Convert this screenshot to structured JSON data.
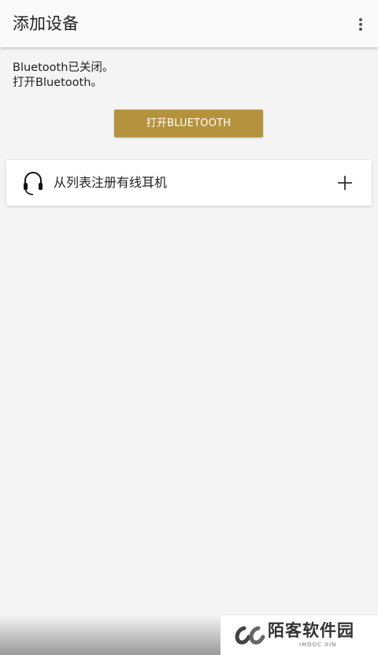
{
  "app_bar": {
    "title": "添加设备",
    "menu_icon": "more-vert-icon"
  },
  "status": {
    "line1": "Bluetooth已关闭。",
    "line2": "打开Bluetooth。"
  },
  "enable_button": {
    "label": "打开BLUETOOTH"
  },
  "device_card": {
    "icon": "headset-icon",
    "label": "从列表注册有线耳机",
    "action_icon": "plus-icon"
  },
  "watermark": {
    "name": "陌客软件园",
    "domain": "IMOOC.XIN"
  },
  "colors": {
    "accent": "#b5923e",
    "background": "#f4f4f4",
    "app_bar": "#fafafa"
  }
}
